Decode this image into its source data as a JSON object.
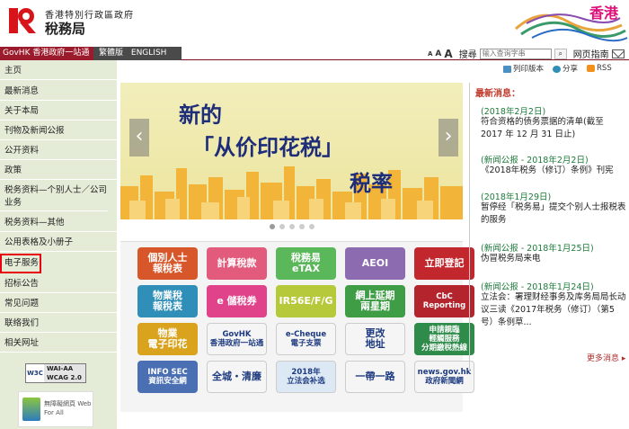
{
  "header": {
    "dept_line": "香港特別行政區政府",
    "dept_name": "稅務局",
    "hk_brand": "香港"
  },
  "govbar": {
    "govhk": "GovHK 香港政府一站通",
    "lang_trad": "繁體版",
    "lang_en": "ENGLISH",
    "font_a1": "A",
    "font_a2": "A",
    "font_a3": "A",
    "search_label": "搜尋",
    "search_placeholder": "输入查询字串",
    "search_icon": "⌕",
    "site_guide": "网页指南"
  },
  "sidebar": {
    "items": [
      {
        "label": "主页"
      },
      {
        "label": "最新消息"
      },
      {
        "label": "关于本局"
      },
      {
        "label": "刊物及新闻公报"
      },
      {
        "label": "公开资料"
      },
      {
        "label": "政策"
      },
      {
        "label": "税务资料—个别人士／公司业务"
      },
      {
        "label": "税务资料—其他"
      },
      {
        "label": "公用表格及小册子"
      },
      {
        "label": "电子服务"
      },
      {
        "label": "招标公告"
      },
      {
        "label": "常见问题"
      },
      {
        "label": "联络我们"
      },
      {
        "label": "相关网址"
      }
    ],
    "w3c_left": "W3C",
    "w3c_right": "WAI-AA WCAG 2.0",
    "web_badge": "無障礙網頁 Web For All"
  },
  "share": {
    "print": "列印版本",
    "share": "分享",
    "rss": "RSS"
  },
  "carousel": {
    "line1": "新的",
    "line2": "「从价印花税」",
    "line3": "税率"
  },
  "tiles": [
    {
      "label": "個別人士\n報稅表",
      "bg": "#d8572a"
    },
    {
      "label": "計算稅款",
      "bg": "#e25b7c"
    },
    {
      "label": "稅務易\neTAX",
      "bg": "#5bb85a"
    },
    {
      "label": "AEOI",
      "bg": "#8c6bb1"
    },
    {
      "label": "立即登記",
      "bg": "#c2272d"
    },
    {
      "label": "物業稅\n報稅表",
      "bg": "#2f8fb8"
    },
    {
      "label": "e 儲稅券",
      "bg": "#e0438a"
    },
    {
      "label": "IR56E/F/G",
      "bg": "#b6c93a"
    },
    {
      "label": "網上延期\n兩星期",
      "bg": "#3f9d45"
    },
    {
      "label": "CbC\nReporting",
      "bg": "#b3242d"
    },
    {
      "label": "物業\n電子印花",
      "bg": "#d9a31d"
    },
    {
      "label": "GovHK\n香港政府一站通",
      "bg": "#f5f5f5"
    },
    {
      "label": "e-Cheque\n電子支票",
      "bg": "#f5f5f5"
    },
    {
      "label": "更改\n地址",
      "bg": "#f5f5f5"
    },
    {
      "label": "申請親臨\n輕觸服務\n分期繳稅熱線",
      "bg": "#2e8b4a"
    },
    {
      "label": "INFO SEC\n資訊安全網",
      "bg": "#4a6fb2"
    },
    {
      "label": "全城・清廉",
      "bg": "#f5f5f5"
    },
    {
      "label": "2018年\n立法会补选",
      "bg": "#dce9f5"
    },
    {
      "label": "一帶一路",
      "bg": "#f5f5f5"
    },
    {
      "label": "news.gov.hk\n政府新聞網",
      "bg": "#f5f5f5"
    }
  ],
  "news": {
    "title": "最新消息：",
    "items": [
      {
        "date": "(2018年2月2日)",
        "text": "符合资格的债务票据的清单(截至 2017 年 12 月 31 日止)"
      },
      {
        "date": "(新闻公报 - 2018年2月2日)",
        "text": "《2018年税务（修订）条例》刊宪"
      },
      {
        "date": "(2018年1月29日)",
        "text": "暂停经「税务易」提交个别人士报税表的服务"
      },
      {
        "date": "(新闻公报 - 2018年1月25日)",
        "text": "伪冒税务局来电"
      },
      {
        "date": "(新闻公报 - 2018年1月24日)",
        "text": "立法会：署理财经事务及库务局局长动议三读《2017年税务（修订）（第5号）条例草..."
      }
    ],
    "more": "更多消息 ▸"
  }
}
